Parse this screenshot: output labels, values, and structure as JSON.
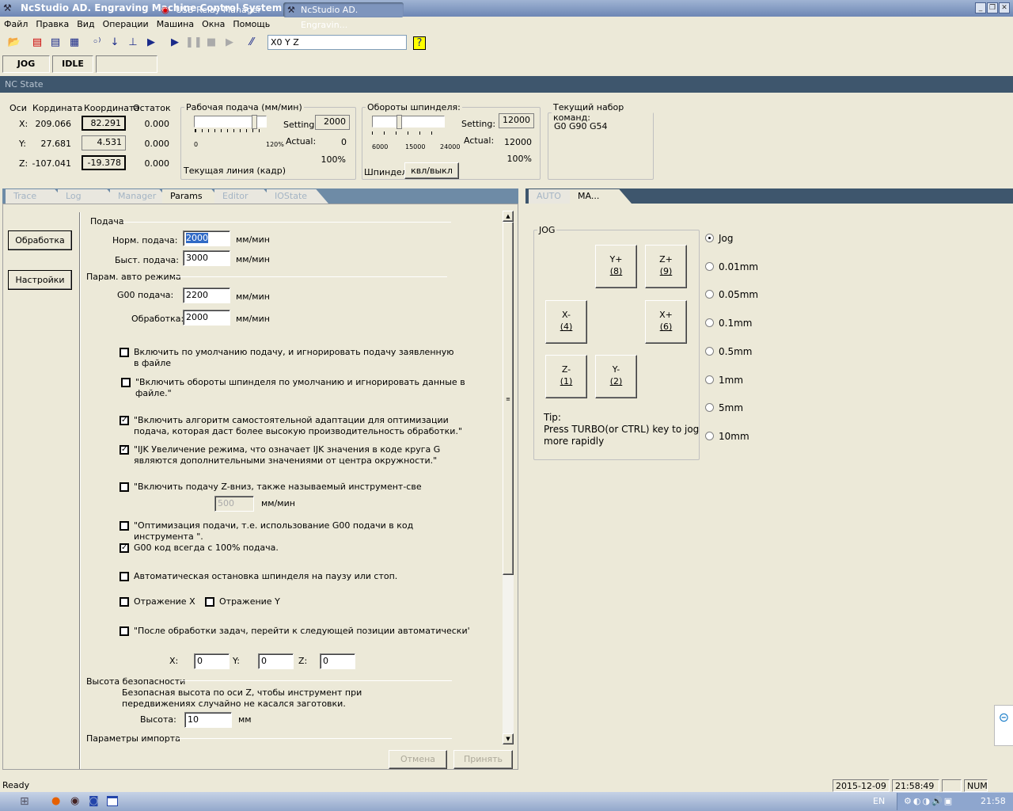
{
  "window": {
    "title": "NcStudio AD. Engraving Machine Control System  - 1"
  },
  "menu": [
    "Файл",
    "Правка",
    "Вид",
    "Операции",
    "Машина",
    "Окна",
    "Помощь"
  ],
  "toolbar": {
    "coord_field": "X0       Y        Z"
  },
  "mode": {
    "jog": "JOG",
    "idle": "IDLE"
  },
  "nc_state": {
    "title": "NC State",
    "headers": [
      "Оси",
      "Кордината",
      "Координата",
      "Остаток"
    ],
    "axes": [
      {
        "axis": "X:",
        "machine": "209.066",
        "work": "82.291",
        "remain": "0.000"
      },
      {
        "axis": "Y:",
        "machine": "27.681",
        "work": "4.531",
        "remain": "0.000"
      },
      {
        "axis": "Z:",
        "machine": "-107.041",
        "work": "-19.378",
        "remain": "0.000"
      }
    ],
    "feed": {
      "legend": "Рабочая подача (мм/мин)",
      "setting_label": "Setting:",
      "setting": "2000",
      "actual_label": "Actual:",
      "actual": "0",
      "percent": "100%",
      "min": "0",
      "max": "120%",
      "line_label": "Текущая линия (кадр)",
      "slider_percent": 100
    },
    "spindle": {
      "legend": "Обороты шпинделя:",
      "setting_label": "Setting:",
      "setting": "12000",
      "actual_label": "Actual:",
      "actual": "12000",
      "percent": "100%",
      "ticks": [
        "6000",
        "15000",
        "24000"
      ],
      "label": "Шпиндел",
      "button": "квл/выкл",
      "slider_value": 12000
    },
    "commands": {
      "legend": "Текущий набор команд:",
      "value": "G0 G90 G54"
    }
  },
  "left_tabs": [
    "Trace",
    "Log",
    "Manager",
    "Params",
    "Editor",
    "IOState"
  ],
  "right_tabs": [
    "AUTO",
    "MA..."
  ],
  "side_buttons": [
    "Обработка",
    "Настройки"
  ],
  "params": {
    "feed_section": "Подача",
    "norm_label": "Норм. подача:",
    "norm": "2000",
    "fast_label": "Быст. подача:",
    "fast": "3000",
    "unit": "мм/мин",
    "auto_section": "Парам. авто режима",
    "g00_label": "G00 подача:",
    "g00": "2200",
    "proc_label": "Обработка:",
    "proc": "2000",
    "checks": [
      {
        "text": "Включить по умолчанию подачу, и игнорировать подачу заявленную",
        "text2": "в файле",
        "checked": false
      },
      {
        "text": "\"Включить обороты шпинделя по умолчанию и игнорировать данные в",
        "text2": "файле.\"",
        "checked": false
      },
      {
        "text": "\"Включить алгоритм самостоятельной адаптации для оптимизации",
        "text2": "подача, которая даст более высокую производительность обработки.\"",
        "checked": true
      },
      {
        "text": "\"IJK Увеличение режима, что означает IJK значения в коде круга G",
        "text2": "являются дополнительными значениями от центра окружности.\"",
        "checked": true
      },
      {
        "text": "\"Включить подачу Z-вниз, также называемый инструмент-све",
        "checked": false
      },
      {
        "text": "\"Оптимизация подачи, т.е. использование G00 подачи в код",
        "text2": "инструмента \".",
        "checked": false
      },
      {
        "text": "G00 код всегда с 100% подача.",
        "checked": true
      },
      {
        "text": "Автоматическая остановка шпинделя на паузу или стоп.",
        "checked": false
      },
      {
        "text": "Отражение  X",
        "checked": false
      },
      {
        "text": "Отражение  Y",
        "checked": false
      },
      {
        "text": "\"После обработки задач, перейти к следующей позиции автоматически'",
        "checked": false
      }
    ],
    "zdown": "500",
    "next_x_label": "X:",
    "next_x": "0",
    "next_y_label": "Y:",
    "next_y": "0",
    "next_z_label": "Z:",
    "next_z": "0",
    "safe_section": "Высота безопасности",
    "safe_desc1": "Безопасная высота по оси Z, чтобы инструмент при",
    "safe_desc2": "передвижениях случайно не касался заготовки.",
    "height_label": "Высота:",
    "height": "10",
    "height_unit": "мм",
    "import_section": "Параметры импорта",
    "cancel": "Отмена",
    "apply": "Принять"
  },
  "jog": {
    "legend": "JOG",
    "buttons": [
      {
        "l": "Y+",
        "k": "(8)"
      },
      {
        "l": "Z+",
        "k": "(9)"
      },
      {
        "l": "X-",
        "k": "(4)"
      },
      {
        "l": "X+",
        "k": "(6)"
      },
      {
        "l": "Z-",
        "k": "(1)"
      },
      {
        "l": "Y-",
        "k": "(2)"
      }
    ],
    "tip1": "Tip:",
    "tip2": "Press TURBO(or CTRL) key to jog",
    "tip3": "more rapidly",
    "steps": [
      "Jog",
      "0.01mm",
      "0.05mm",
      "0.1mm",
      "0.5mm",
      "1mm",
      "5mm",
      "10mm"
    ],
    "selected": "Jog"
  },
  "status": {
    "text": "Ready",
    "date": "2015-12-09",
    "time": "21:58:49",
    "num": "NUM"
  },
  "taskbar": {
    "items": [
      "USB Relay Manager",
      "NcStudio AD. Engravin..."
    ],
    "lang": "EN",
    "clock": "21:58"
  }
}
